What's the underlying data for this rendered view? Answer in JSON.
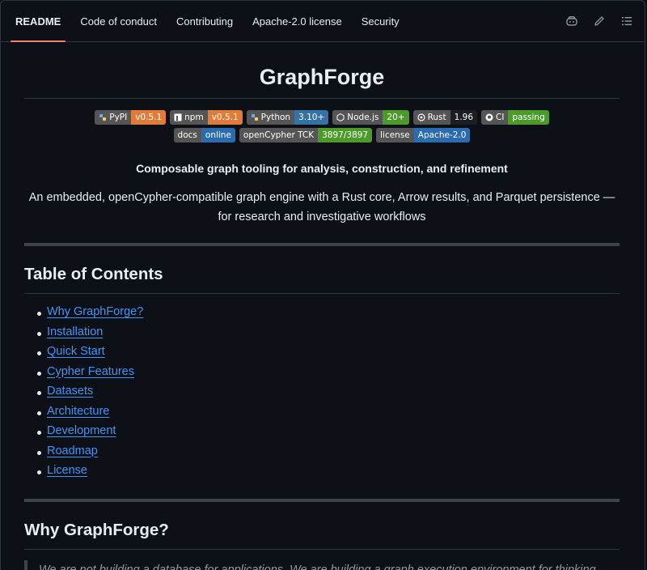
{
  "tabs": [
    {
      "label": "README",
      "active": true
    },
    {
      "label": "Code of conduct"
    },
    {
      "label": "Contributing"
    },
    {
      "label": "Apache-2.0 license"
    },
    {
      "label": "Security"
    }
  ],
  "title": "GraphForge",
  "badges": [
    {
      "label": "PyPI",
      "value": "v0.5.1",
      "color": "#e07b39",
      "icon": "python-icon"
    },
    {
      "label": "npm",
      "value": "v0.5.1",
      "color": "#e07b39",
      "icon": "npm-icon"
    },
    {
      "label": "Python",
      "value": "3.10+",
      "color": "#3572a5",
      "icon": "python-icon"
    },
    {
      "label": "Node.js",
      "value": "20+",
      "color": "#4c9a2a",
      "icon": "nodejs-icon"
    },
    {
      "label": "Rust",
      "value": "1.96",
      "color": "#1b1f24",
      "icon": "rust-icon"
    },
    {
      "label": "CI",
      "value": "passing",
      "color": "#4c9a2a",
      "icon": "github-icon"
    },
    {
      "label": "docs",
      "value": "online",
      "color": "#2b6cb0",
      "icon": ""
    },
    {
      "label": "openCypher TCK",
      "value": "3897/3897",
      "color": "#4c9a2a",
      "icon": ""
    },
    {
      "label": "license",
      "value": "Apache-2.0",
      "color": "#2b6cb0",
      "icon": ""
    }
  ],
  "tagline": "Composable graph tooling for analysis, construction, and refinement",
  "description": "An embedded, openCypher-compatible graph engine with a Rust core, Arrow results, and Parquet persistence — for research and investigative workflows",
  "toc": {
    "heading": "Table of Contents",
    "items": [
      "Why GraphForge?",
      "Installation",
      "Quick Start",
      "Cypher Features",
      "Datasets",
      "Architecture",
      "Development",
      "Roadmap",
      "License"
    ]
  },
  "why": {
    "heading": "Why GraphForge?",
    "quote": "We are not building a database for applications. We are building a graph execution environment for thinking."
  }
}
